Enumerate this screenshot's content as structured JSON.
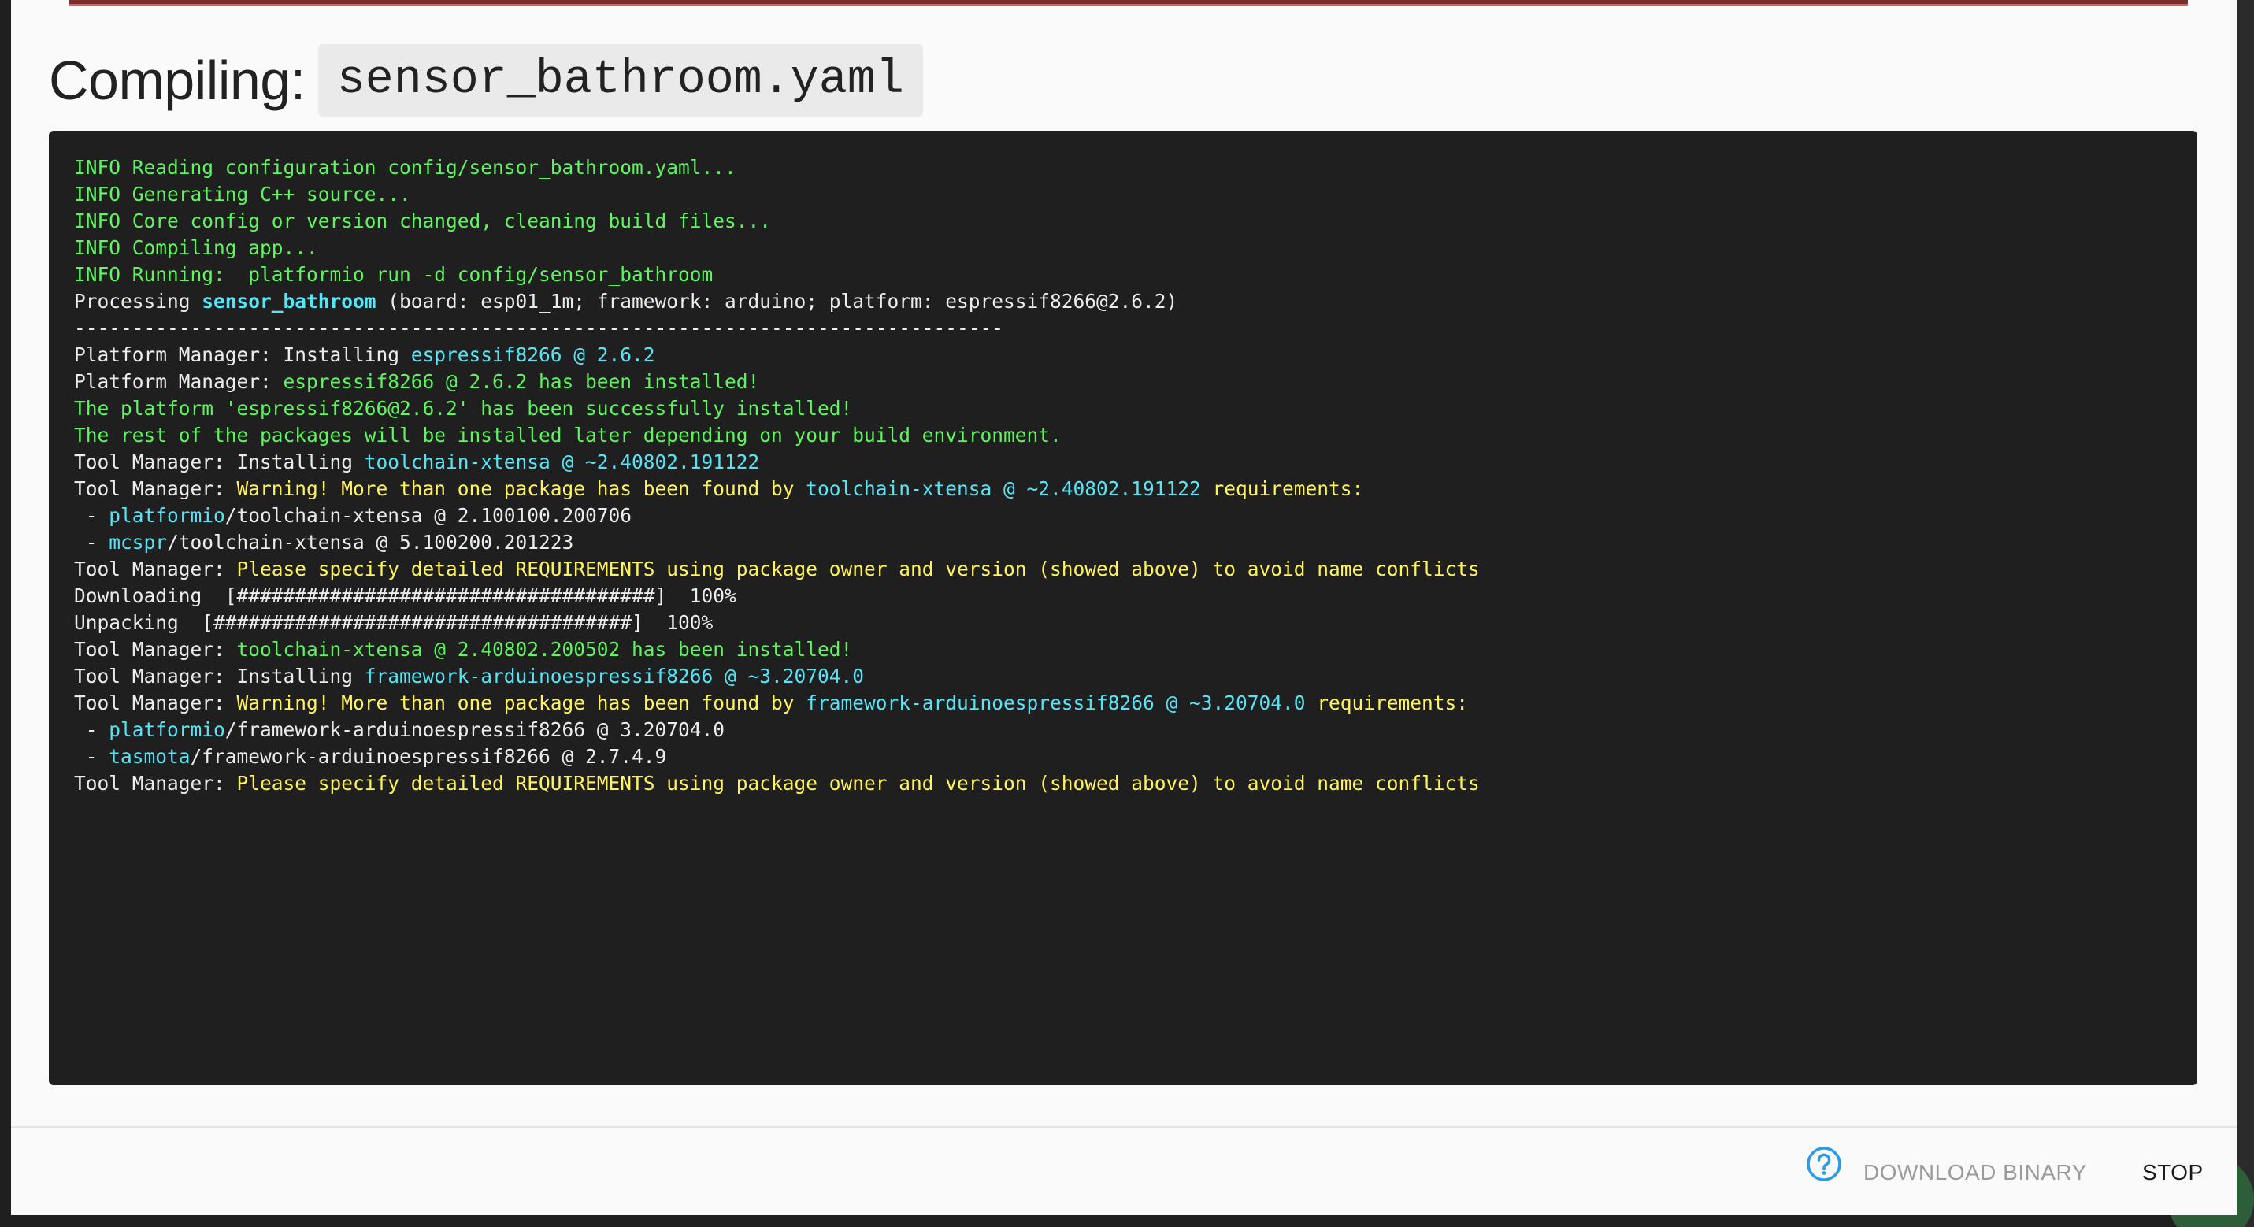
{
  "title": {
    "label": "Compiling:",
    "filename": "sensor_bathroom.yaml"
  },
  "colors": {
    "default": "#ececec",
    "green": "#5ff55f",
    "yellow": "#fff35c",
    "cyan": "#57e4f5",
    "terminal_bg": "#1f1f1f",
    "help_icon": "#2a9be6"
  },
  "log": [
    [
      [
        "g",
        "INFO Reading configuration config/sensor_bathroom.yaml..."
      ]
    ],
    [
      [
        "g",
        "INFO Generating C++ source..."
      ]
    ],
    [
      [
        "g",
        "INFO Core config or version changed, cleaning build files..."
      ]
    ],
    [
      [
        "g",
        "INFO Compiling app..."
      ]
    ],
    [
      [
        "g",
        "INFO Running:  platformio run -d config/sensor_bathroom"
      ]
    ],
    [
      [
        "d",
        "Processing "
      ],
      [
        "cb",
        "sensor_bathroom"
      ],
      [
        "d",
        " (board: esp01_1m; framework: arduino; platform: espressif8266@2.6.2)"
      ]
    ],
    [
      [
        "d",
        "--------------------------------------------------------------------------------"
      ]
    ],
    [
      [
        "d",
        "Platform Manager: Installing "
      ],
      [
        "c",
        "espressif8266 @ 2.6.2"
      ]
    ],
    [
      [
        "d",
        "Platform Manager: "
      ],
      [
        "g",
        "espressif8266 @ 2.6.2 has been installed!"
      ]
    ],
    [
      [
        "g",
        "The platform 'espressif8266@2.6.2' has been successfully installed!"
      ]
    ],
    [
      [
        "g",
        "The rest of the packages will be installed later depending on your build environment."
      ]
    ],
    [
      [
        "d",
        "Tool Manager: Installing "
      ],
      [
        "c",
        "toolchain-xtensa @ ~2.40802.191122"
      ]
    ],
    [
      [
        "d",
        "Tool Manager: "
      ],
      [
        "y",
        "Warning! More than one package has been found by "
      ],
      [
        "c",
        "toolchain-xtensa @ ~2.40802.191122"
      ],
      [
        "y",
        " requirements:"
      ]
    ],
    [
      [
        "d",
        " - "
      ],
      [
        "c",
        "platformio"
      ],
      [
        "d",
        "/toolchain-xtensa @ 2.100100.200706"
      ]
    ],
    [
      [
        "d",
        " - "
      ],
      [
        "c",
        "mcspr"
      ],
      [
        "d",
        "/toolchain-xtensa @ 5.100200.201223"
      ]
    ],
    [
      [
        "d",
        "Tool Manager: "
      ],
      [
        "y",
        "Please specify detailed REQUIREMENTS using package owner and version (showed above) to avoid name conflicts"
      ]
    ],
    [
      [
        "d",
        "Downloading  [####################################]  100%"
      ]
    ],
    [
      [
        "d",
        "Unpacking  [####################################]  100%"
      ]
    ],
    [
      [
        "d",
        "Tool Manager: "
      ],
      [
        "g",
        "toolchain-xtensa @ 2.40802.200502 has been installed!"
      ]
    ],
    [
      [
        "d",
        "Tool Manager: Installing "
      ],
      [
        "c",
        "framework-arduinoespressif8266 @ ~3.20704.0"
      ]
    ],
    [
      [
        "d",
        "Tool Manager: "
      ],
      [
        "y",
        "Warning! More than one package has been found by "
      ],
      [
        "c",
        "framework-arduinoespressif8266 @ ~3.20704.0"
      ],
      [
        "y",
        " requirements:"
      ]
    ],
    [
      [
        "d",
        " - "
      ],
      [
        "c",
        "platformio"
      ],
      [
        "d",
        "/framework-arduinoespressif8266 @ 3.20704.0"
      ]
    ],
    [
      [
        "d",
        " - "
      ],
      [
        "c",
        "tasmota"
      ],
      [
        "d",
        "/framework-arduinoespressif8266 @ 2.7.4.9"
      ]
    ],
    [
      [
        "d",
        "Tool Manager: "
      ],
      [
        "y",
        "Please specify detailed REQUIREMENTS using package owner and version (showed above) to avoid name conflicts"
      ]
    ]
  ],
  "footer": {
    "help_icon": "help-circle-icon",
    "download_label": "DOWNLOAD BINARY",
    "stop_label": "STOP"
  }
}
